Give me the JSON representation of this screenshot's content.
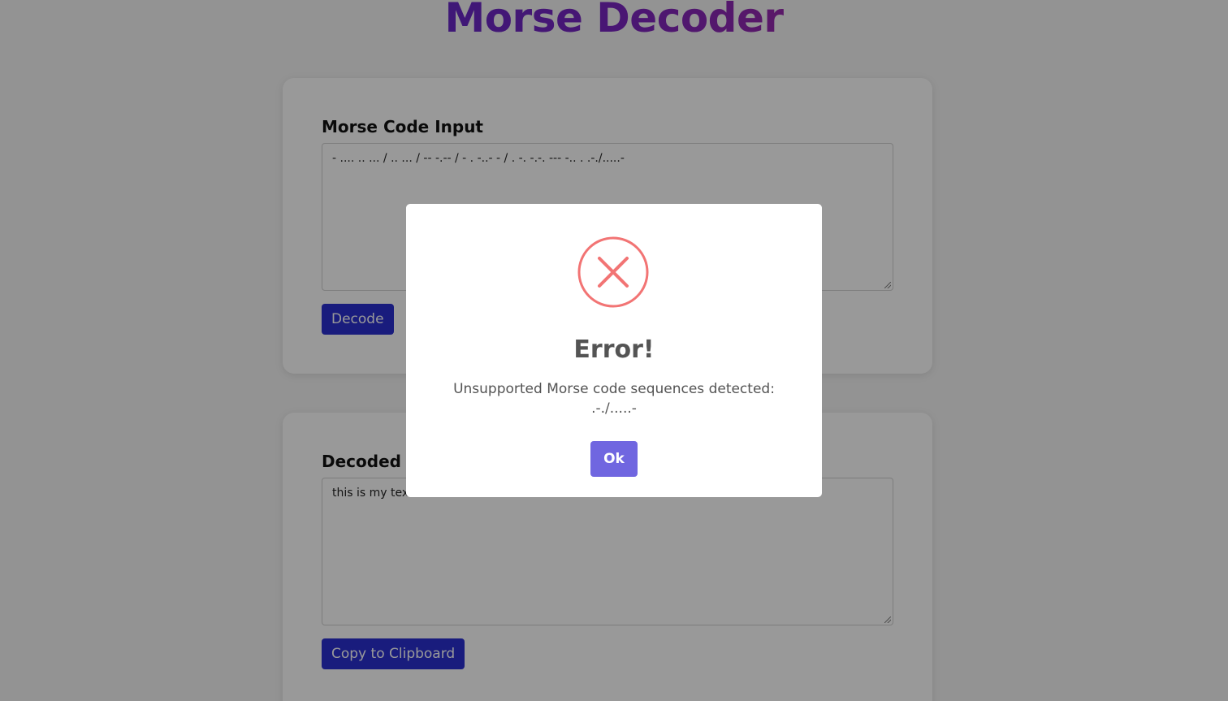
{
  "header": {
    "title": "Morse Decoder"
  },
  "input_card": {
    "label": "Morse Code Input",
    "value": "- .... .. ... / .. ... / -- -.-- / - . -..- - / . -. -.-. --- -.. . .-./.....-",
    "button_label": "Decode"
  },
  "output_card": {
    "label": "Decoded Text",
    "value": "this is my text encoded",
    "button_label": "Copy to Clipboard"
  },
  "modal": {
    "title": "Error!",
    "message_line1": "Unsupported Morse code sequences detected:",
    "message_line2": ".-./.....-",
    "ok_label": "Ok",
    "icon": "x-circle-icon",
    "icon_color": "#f27474"
  },
  "colors": {
    "primary_button": "#2a2fd0",
    "modal_button": "#7066e0",
    "title_gradient": [
      "#3b2bd6",
      "#e0307a"
    ]
  }
}
